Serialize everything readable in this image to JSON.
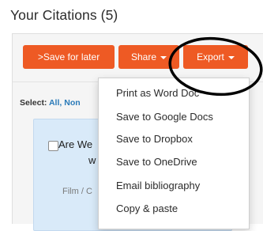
{
  "header": {
    "title": "Your Citations (5)"
  },
  "toolbar": {
    "save_label": ">Save for later",
    "share_label": "Share",
    "export_label": "Export"
  },
  "select_row": {
    "prefix": "Select:",
    "all": "All,",
    "none": "Non"
  },
  "citation_card": {
    "title_line1": "Are We",
    "title_line2": "w",
    "meta": "Film / C"
  },
  "export_menu": {
    "items": [
      "Print as Word Doc",
      "Save to Google Docs",
      "Save to Dropbox",
      "Save to OneDrive",
      "Email bibliography",
      "Copy & paste"
    ]
  },
  "colors": {
    "button_accent": "#ee5a24",
    "link": "#2a7ab8",
    "card_background": "#d9eaf9",
    "annotation_circle": "#000000"
  },
  "icons": [
    "caret-down-icon",
    "checkbox-icon"
  ]
}
